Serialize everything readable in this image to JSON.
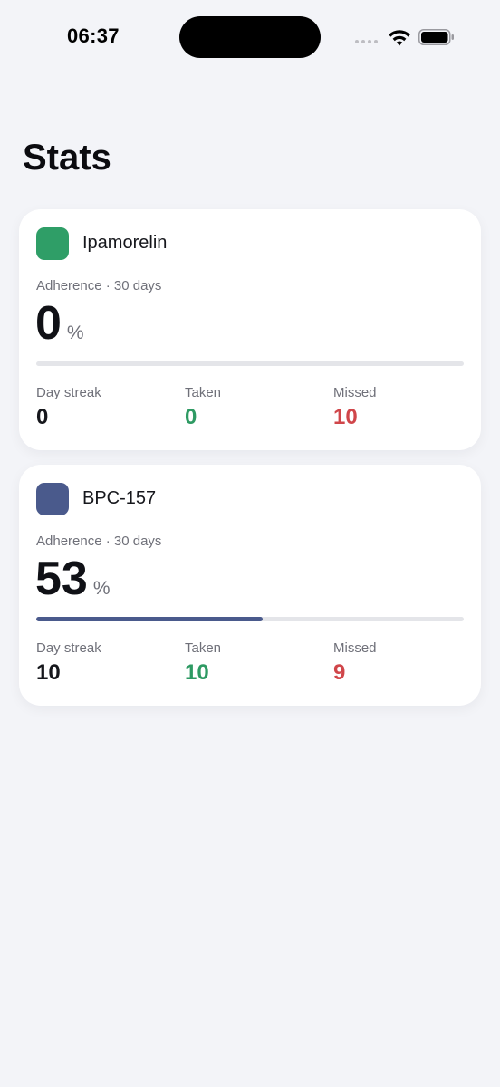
{
  "status_bar": {
    "time": "06:37"
  },
  "page": {
    "title": "Stats"
  },
  "colors": {
    "background": "#f3f4f8",
    "taken": "#2e9a63",
    "missed": "#d0464a",
    "streak": "#16171c"
  },
  "icons": {
    "signal": "signal-dots-icon",
    "wifi": "wifi-icon",
    "battery": "battery-icon"
  },
  "cards": [
    {
      "name": "Ipamorelin",
      "swatch_color": "#2f9e67",
      "adherence_label": "Adherence · 30 days",
      "adherence_value": "0",
      "adherence_unit": "%",
      "adherence_fraction": 0.0,
      "progress_color": "#4a5a8c",
      "day_streak_label": "Day streak",
      "day_streak_value": "0",
      "taken_label": "Taken",
      "taken_value": "0",
      "missed_label": "Missed",
      "missed_value": "10"
    },
    {
      "name": "BPC-157",
      "swatch_color": "#4a5a8c",
      "adherence_label": "Adherence · 30 days",
      "adherence_value": "53",
      "adherence_unit": "%",
      "adherence_fraction": 0.53,
      "progress_color": "#4a5a8c",
      "day_streak_label": "Day streak",
      "day_streak_value": "10",
      "taken_label": "Taken",
      "taken_value": "10",
      "missed_label": "Missed",
      "missed_value": "9"
    }
  ]
}
